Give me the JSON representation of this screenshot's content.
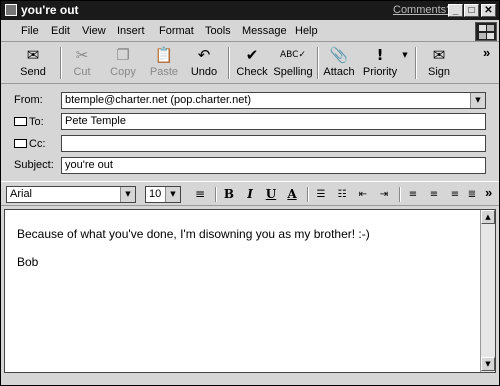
{
  "titlebar": {
    "title": "you're out",
    "comments_link": "Comments?",
    "minimize": "_",
    "maximize": "□",
    "close": "✕"
  },
  "menu": [
    "File",
    "Edit",
    "View",
    "Insert",
    "Format",
    "Tools",
    "Message",
    "Help"
  ],
  "toolbar": [
    {
      "label": "Send",
      "icon": "✉",
      "enabled": true
    },
    {
      "label": "Cut",
      "icon": "✂",
      "enabled": false
    },
    {
      "label": "Copy",
      "icon": "❐",
      "enabled": false
    },
    {
      "label": "Paste",
      "icon": "📋",
      "enabled": false
    },
    {
      "label": "Undo",
      "icon": "↶",
      "enabled": true
    },
    {
      "label": "Check",
      "icon": "✔",
      "enabled": true
    },
    {
      "label": "Spelling",
      "icon": "ABC✓",
      "enabled": true
    },
    {
      "label": "Attach",
      "icon": "📎",
      "enabled": true
    },
    {
      "label": "Priority",
      "icon": "!",
      "enabled": true
    },
    {
      "label": "Sign",
      "icon": "✉",
      "enabled": true
    }
  ],
  "toolbar_overflow": "»",
  "header": {
    "from_label": "From:",
    "from_value": "btemple@charter.net    (pop.charter.net)",
    "to_label": "To:",
    "to_value": "Pete Temple",
    "cc_label": "Cc:",
    "cc_value": "",
    "subject_label": "Subject:",
    "subject_value": "you're out"
  },
  "format": {
    "font": "Arial",
    "size": "10",
    "bold": "B",
    "italic": "I",
    "underline": "U",
    "font_color": "A",
    "overflow": "»"
  },
  "message": {
    "line1": "Because of what you've done, I'm disowning you as my brother!  :-)",
    "line2": "Bob"
  }
}
